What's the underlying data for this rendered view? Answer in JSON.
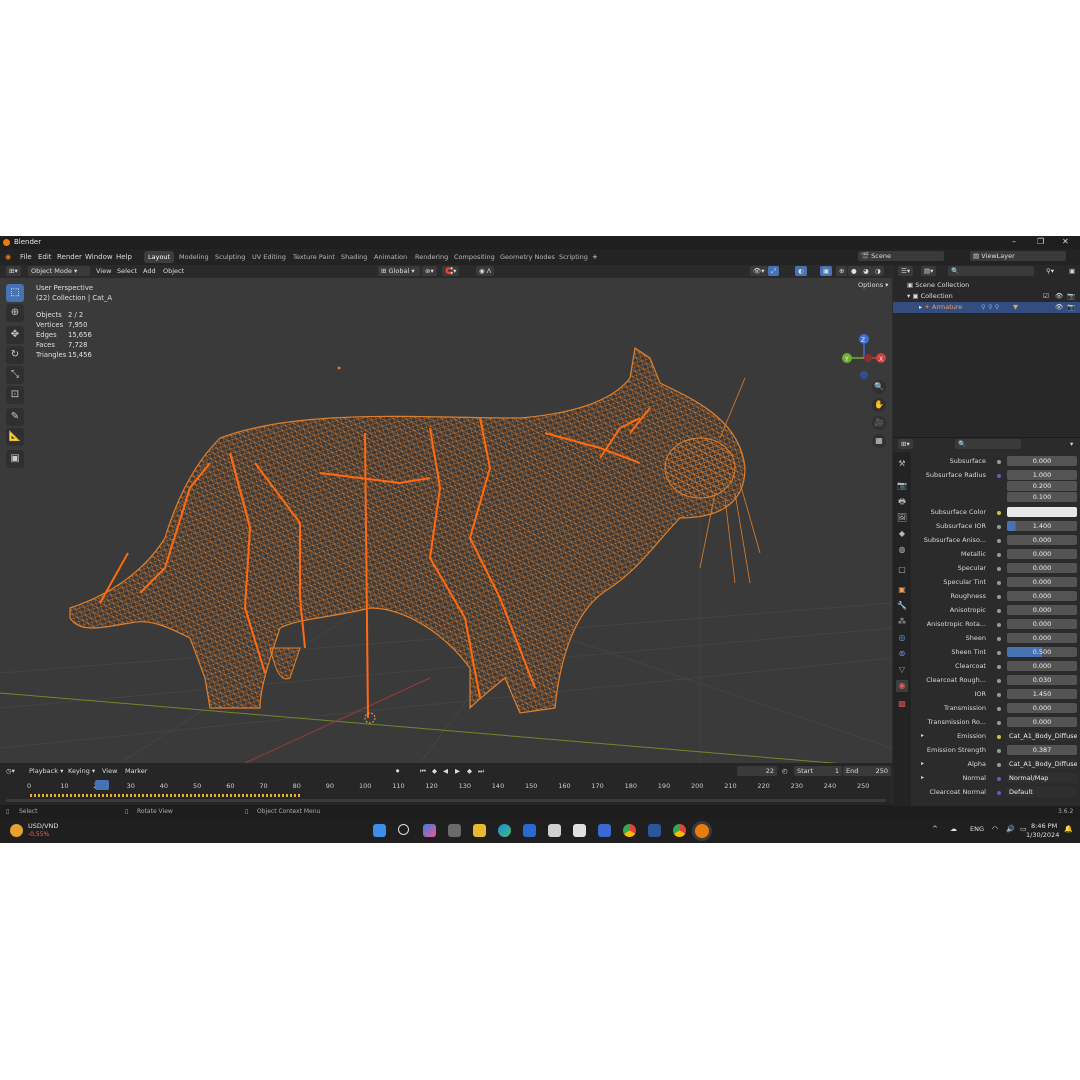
{
  "app": {
    "title": "Blender",
    "version": "3.6.2"
  },
  "menu": [
    "File",
    "Edit",
    "Render",
    "Window",
    "Help"
  ],
  "workspaces": [
    "Layout",
    "Modeling",
    "Sculpting",
    "UV Editing",
    "Texture Paint",
    "Shading",
    "Animation",
    "Rendering",
    "Compositing",
    "Geometry Nodes",
    "Scripting"
  ],
  "active_workspace": "Layout",
  "scene": "Scene",
  "view_layer": "ViewLayer",
  "header": {
    "mode": "Object Mode",
    "view": "View",
    "select": "Select",
    "add": "Add",
    "object": "Object",
    "transform": "Global",
    "options": "Options"
  },
  "viewport": {
    "perspective": "User Perspective",
    "collection": "(22) Collection | Cat_A",
    "stats": [
      {
        "label": "Objects",
        "value": "2 / 2"
      },
      {
        "label": "Vertices",
        "value": "7,950"
      },
      {
        "label": "Edges",
        "value": "15,656"
      },
      {
        "label": "Faces",
        "value": "7,728"
      },
      {
        "label": "Triangles",
        "value": "15,456"
      }
    ],
    "gizmo": {
      "x": "X",
      "y": "Y",
      "z": "Z"
    }
  },
  "outliner": {
    "scene_collection": "Scene Collection",
    "collection": "Collection",
    "armature": "Armature"
  },
  "properties": [
    {
      "label": "Subsurface",
      "value": "0.000"
    },
    {
      "label": "Subsurface Radius",
      "value": "1.000"
    },
    {
      "label": "",
      "value": "0.200"
    },
    {
      "label": "",
      "value": "0.100"
    },
    {
      "label": "Subsurface Color",
      "value": ""
    },
    {
      "label": "Subsurface IOR",
      "value": "1.400"
    },
    {
      "label": "Subsurface Aniso...",
      "value": "0.000"
    },
    {
      "label": "Metallic",
      "value": "0.000"
    },
    {
      "label": "Specular",
      "value": "0.000"
    },
    {
      "label": "Specular Tint",
      "value": "0.000"
    },
    {
      "label": "Roughness",
      "value": "0.000"
    },
    {
      "label": "Anisotropic",
      "value": "0.000"
    },
    {
      "label": "Anisotropic Rota...",
      "value": "0.000"
    },
    {
      "label": "Sheen",
      "value": "0.000"
    },
    {
      "label": "Sheen Tint",
      "value": "0.500"
    },
    {
      "label": "Clearcoat",
      "value": "0.000"
    },
    {
      "label": "Clearcoat Rough...",
      "value": "0.030"
    },
    {
      "label": "IOR",
      "value": "1.450"
    },
    {
      "label": "Transmission",
      "value": "0.000"
    },
    {
      "label": "Transmission Ro...",
      "value": "0.000"
    },
    {
      "label": "Emission",
      "value": "Cat_A1_Body_Diffuse"
    },
    {
      "label": "Emission Strength",
      "value": "0.387"
    },
    {
      "label": "Alpha",
      "value": "Cat_A1_Body_Diffuse..."
    },
    {
      "label": "Normal",
      "value": "Normal/Map"
    },
    {
      "label": "Clearcoat Normal",
      "value": "Default"
    }
  ],
  "timeline": {
    "playback": "Playback",
    "keying": "Keying",
    "view": "View",
    "marker": "Marker",
    "current_frame": "22",
    "start_label": "Start",
    "start": "1",
    "end_label": "End",
    "end": "250",
    "ticks": [
      "0",
      "10",
      "20",
      "30",
      "40",
      "50",
      "60",
      "70",
      "80",
      "90",
      "100",
      "110",
      "120",
      "130",
      "140",
      "150",
      "160",
      "170",
      "180",
      "190",
      "200",
      "210",
      "220",
      "230",
      "240",
      "250"
    ]
  },
  "statusbar": {
    "select": "Select",
    "rotate": "Rotate View",
    "context": "Object Context Menu"
  },
  "taskbar": {
    "ticker": "USD/VND",
    "change": "-0,55%",
    "lang": "ENG",
    "time": "8:46 PM",
    "date": "1/30/2024"
  },
  "colors": {
    "accent": "#4772b3",
    "selection": "#e87d0d",
    "wire": "#d9782a"
  }
}
